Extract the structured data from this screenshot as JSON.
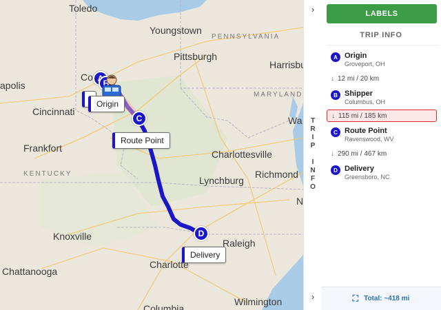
{
  "map": {
    "cities": [
      "Toledo",
      "Youngstown",
      "Pittsburgh",
      "Harrisbu",
      "Co",
      "apolis",
      "Cincinnati",
      "Frankfort",
      "Charlottesville",
      "Lynchburg",
      "Richmond",
      "Knoxville",
      "Raleigh",
      "Chattanooga",
      "Charlotte",
      "Wilmington",
      "Columbia",
      "N",
      "Wa"
    ],
    "states": [
      "PENNSYLVANIA",
      "MARYLAND",
      "KENTUCKY"
    ],
    "markers": [
      "A",
      "B",
      "C",
      "D"
    ],
    "labels": {
      "origin": "Origin",
      "route_point": "Route Point",
      "delivery": "Delivery"
    }
  },
  "strip": {
    "chevron_top": "›",
    "chevron_bottom": "›",
    "vertical": [
      "T",
      "R",
      "I",
      "P",
      "",
      "I",
      "N",
      "F",
      "O"
    ]
  },
  "panel": {
    "labels_button": "LABELS",
    "title": "TRIP INFO",
    "stops": [
      {
        "letter": "A",
        "name": "Origin",
        "location": "Groveport, OH"
      },
      {
        "letter": "B",
        "name": "Shipper",
        "location": "Columbus, OH"
      },
      {
        "letter": "C",
        "name": "Route Point",
        "location": "Ravenswood, WV"
      },
      {
        "letter": "D",
        "name": "Delivery",
        "location": "Greensboro, NC"
      }
    ],
    "legs": [
      "12 mi / 20 km",
      "115 mi / 185 km",
      "290 mi / 467 km"
    ],
    "arrow": "↓",
    "total": "Total: ~418 mi",
    "total_icon": "⛶"
  },
  "colors": {
    "route": "#1b17c9",
    "labels_button": "#3d9d47",
    "active_leg_border": "#e02b2b",
    "water": "#a9cbe6"
  }
}
